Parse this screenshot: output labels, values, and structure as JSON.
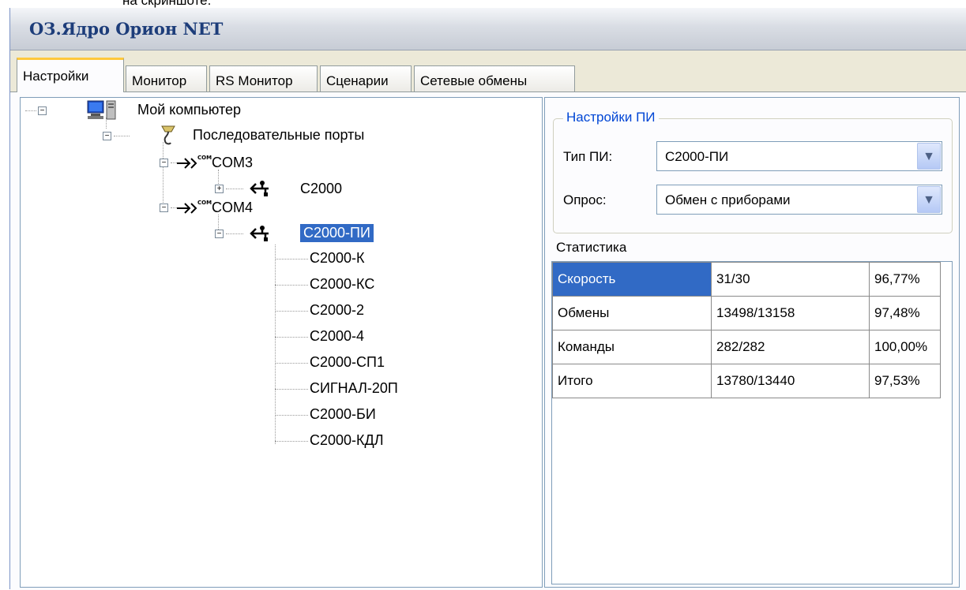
{
  "caption_top": "на скриншоте.",
  "window": {
    "title": "ОЗ.Ядро Орион NET"
  },
  "tabs": [
    "Настройки",
    "Монитор",
    "RS Монитор",
    "Сценарии",
    "Сетевые обмены"
  ],
  "tree": {
    "root": "Мой компьютер",
    "ports": "Последовательные порты",
    "com3": "COM3",
    "com3_device": "C2000",
    "com4": "COM4",
    "com4_device": "С2000-ПИ",
    "com_badge": "COM",
    "children": [
      "С2000-К",
      "С2000-КС",
      "С2000-2",
      "С2000-4",
      "С2000-СП1",
      "СИГНАЛ-20П",
      "С2000-БИ",
      "С2000-КДЛ"
    ]
  },
  "settings": {
    "group_title": "Настройки ПИ",
    "type_label": "Тип ПИ:",
    "type_value": "С2000-ПИ",
    "poll_label": "Опрос:",
    "poll_value": "Обмен с приборами"
  },
  "stats": {
    "title": "Статистика",
    "rows": [
      {
        "name": "Скорость",
        "value": "31/30",
        "percent": "96,77%"
      },
      {
        "name": "Обмены",
        "value": "13498/13158",
        "percent": "97,48%"
      },
      {
        "name": "Команды",
        "value": "282/282",
        "percent": "100,00%"
      },
      {
        "name": "Итого",
        "value": "13780/13440",
        "percent": "97,53%"
      }
    ]
  },
  "colors": {
    "selection": "#316ac5",
    "group_title": "#0046d5",
    "tab_accent": "#ffc83c"
  }
}
